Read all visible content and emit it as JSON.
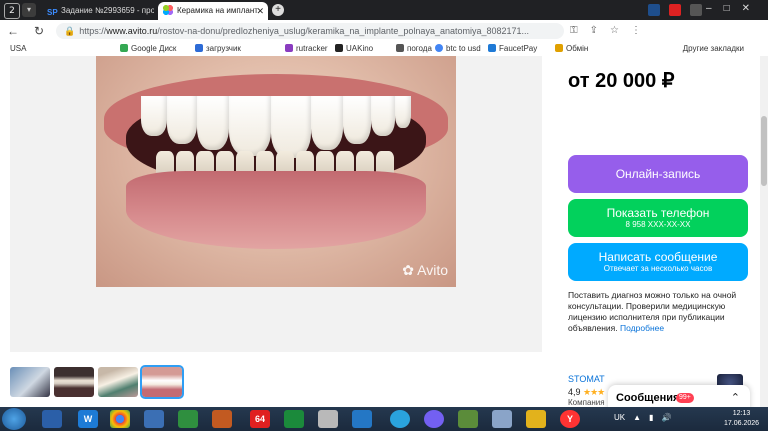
{
  "browser": {
    "tab_counter": "2",
    "tabs": [
      {
        "label": "Задание №2993659 - про"
      },
      {
        "label": "Керамика на имплант"
      }
    ],
    "url_prefix": "https://",
    "url_domain": "www.avito.ru",
    "url_path": "/rostov-na-donu/predlozheniya_uslug/keramika_na_implante_polnaya_anatomiya_8082171...",
    "bookmarks": [
      {
        "label": "USA"
      },
      {
        "label": "Google Диск"
      },
      {
        "label": "загрузчик"
      },
      {
        "label": "rutracker"
      },
      {
        "label": "UAKino"
      },
      {
        "label": "погода"
      },
      {
        "label": "btc to usd"
      },
      {
        "label": "FaucetPay"
      },
      {
        "label": "Обмін"
      },
      {
        "label": "Другие закладки"
      }
    ]
  },
  "listing": {
    "watermark": "Avito",
    "price": "от 20 000 ₽",
    "book_button": "Онлайн-запись",
    "phone_button": "Показать телефон",
    "phone_masked": "8 958 XXX-XX-XX",
    "message_button": "Написать сообщение",
    "message_sub": "Отвечает за несколько часов",
    "note": "Поставить диагноз можно только на очной консультации. Проверили медицинскую лицензию исполнителя при публикации объявления.",
    "note_link": "Подробнее",
    "seller_name": "STOMAT",
    "seller_rating": "4,9",
    "seller_stars": "★★★",
    "seller_type": "Компания",
    "chat_label": "Сообщения",
    "chat_badge": "99+"
  },
  "taskbar": {
    "lang": "UK",
    "time": "12:13",
    "date": "17.06.2026",
    "app_64": "64"
  },
  "colors": {
    "book": "#965eeb",
    "phone": "#02d15c",
    "message": "#00aaff",
    "link": "#0a73d9"
  }
}
